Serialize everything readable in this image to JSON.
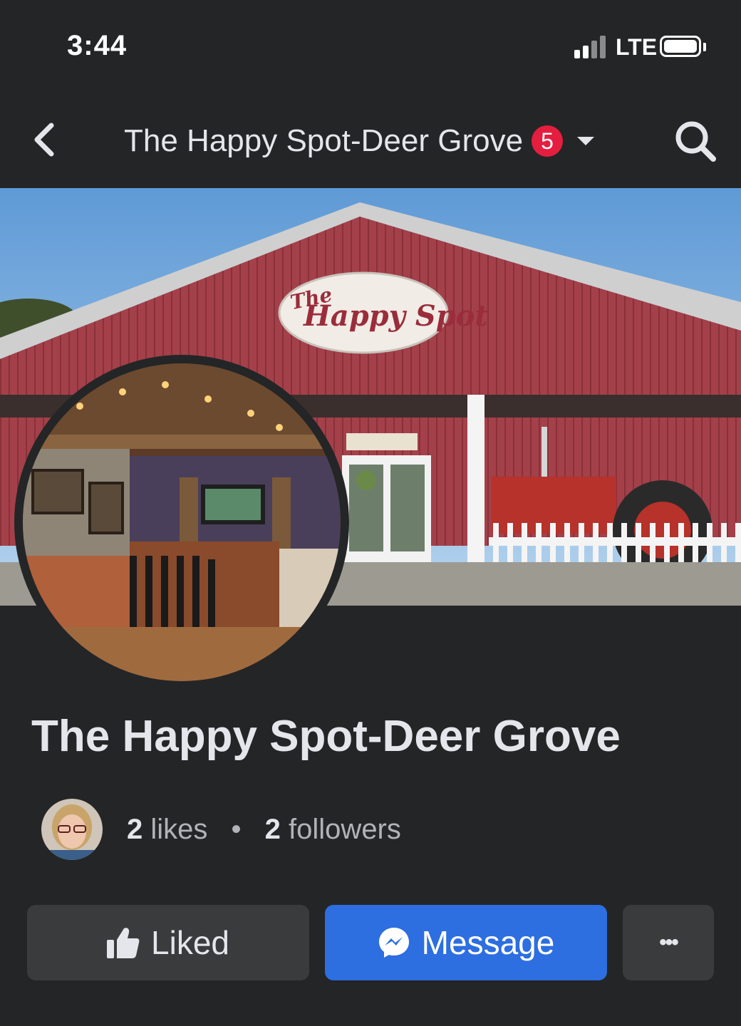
{
  "status_bar": {
    "time": "3:44",
    "network": "LTE"
  },
  "nav": {
    "title": "The Happy Spot-Deer Grove",
    "badge_count": "5",
    "icons": [
      "chevron-left-icon",
      "caret-down-icon",
      "search-icon"
    ]
  },
  "cover": {
    "sign_the": "The",
    "sign_name": "Happy Spot"
  },
  "page": {
    "name": "The Happy Spot-Deer Grove"
  },
  "stats": {
    "likes_count": "2",
    "likes_label": "likes",
    "separator": "•",
    "followers_count": "2",
    "followers_label": "followers"
  },
  "actions": {
    "liked_label": "Liked",
    "message_label": "Message",
    "more_label": "•••"
  },
  "colors": {
    "background": "#242526",
    "badge": "#e41e3f",
    "message_button": "#2d6ee0",
    "secondary_button": "#3a3b3c"
  }
}
